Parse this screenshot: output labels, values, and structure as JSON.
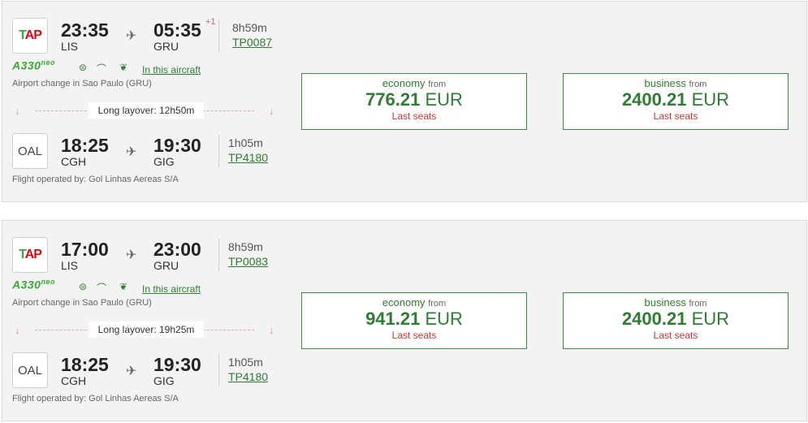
{
  "flights": [
    {
      "leg1": {
        "airline_logo": "tap-logo",
        "dep_time": "23:35",
        "dep_code": "LIS",
        "arr_time": "05:35",
        "arr_code": "GRU",
        "day_offset": "+1",
        "duration": "8h59m",
        "flight_no": "TP0087"
      },
      "aircraft": "A330",
      "aircraft_suffix": "neo",
      "amenities": [
        "wifi-icon",
        "seat-recline-icon",
        "leaf-icon"
      ],
      "aircraft_link": "In this aircraft",
      "airport_change": "Airport change in Sao Paulo (GRU)",
      "layover": "Long layover: 12h50m",
      "leg2": {
        "airline_logo": "OAL",
        "dep_time": "18:25",
        "dep_code": "CGH",
        "arr_time": "19:30",
        "arr_code": "GIG",
        "duration": "1h05m",
        "flight_no": "TP4180"
      },
      "operated_by": "Flight operated by: Gol Linhas Aereas S/A",
      "economy": {
        "label": "economy",
        "from": "from",
        "price": "776.21",
        "currency": "EUR",
        "note": "Last seats"
      },
      "business": {
        "label": "business",
        "from": "from",
        "price": "2400.21",
        "currency": "EUR",
        "note": "Last seats"
      }
    },
    {
      "leg1": {
        "airline_logo": "tap-logo",
        "dep_time": "17:00",
        "dep_code": "LIS",
        "arr_time": "23:00",
        "arr_code": "GRU",
        "day_offset": "",
        "duration": "8h59m",
        "flight_no": "TP0083"
      },
      "aircraft": "A330",
      "aircraft_suffix": "neo",
      "amenities": [
        "wifi-icon",
        "seat-recline-icon",
        "leaf-icon"
      ],
      "aircraft_link": "In this aircraft",
      "airport_change": "Airport change in Sao Paulo (GRU)",
      "layover": "Long layover: 19h25m",
      "leg2": {
        "airline_logo": "OAL",
        "dep_time": "18:25",
        "dep_code": "CGH",
        "arr_time": "19:30",
        "arr_code": "GIG",
        "duration": "1h05m",
        "flight_no": "TP4180"
      },
      "operated_by": "Flight operated by: Gol Linhas Aereas S/A",
      "economy": {
        "label": "economy",
        "from": "from",
        "price": "941.21",
        "currency": "EUR",
        "note": "Last seats"
      },
      "business": {
        "label": "business",
        "from": "from",
        "price": "2400.21",
        "currency": "EUR",
        "note": "Last seats"
      }
    }
  ],
  "colors": {
    "brand_green": "#2e7d32",
    "accent_red": "#e03030",
    "border": "#3d8b3d"
  }
}
